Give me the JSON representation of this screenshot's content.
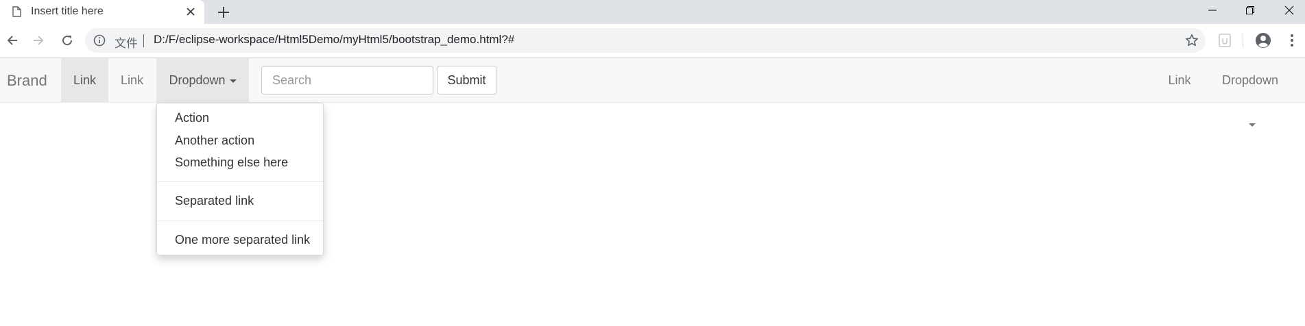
{
  "browser": {
    "tab_title": "Insert title here",
    "site_chip": "文件",
    "url": "D:/F/eclipse-workspace/Html5Demo/myHtml5/bootstrap_demo.html?#"
  },
  "navbar": {
    "brand": "Brand",
    "left_links": [
      "Link",
      "Link"
    ],
    "dropdown_label": "Dropdown",
    "search_placeholder": "Search",
    "submit_label": "Submit",
    "right_link": "Link",
    "right_dropdown_label": "Dropdown"
  },
  "dropdown_menu": {
    "items": [
      "Action",
      "Another action",
      "Something else here",
      "Separated link",
      "One more separated link"
    ]
  }
}
